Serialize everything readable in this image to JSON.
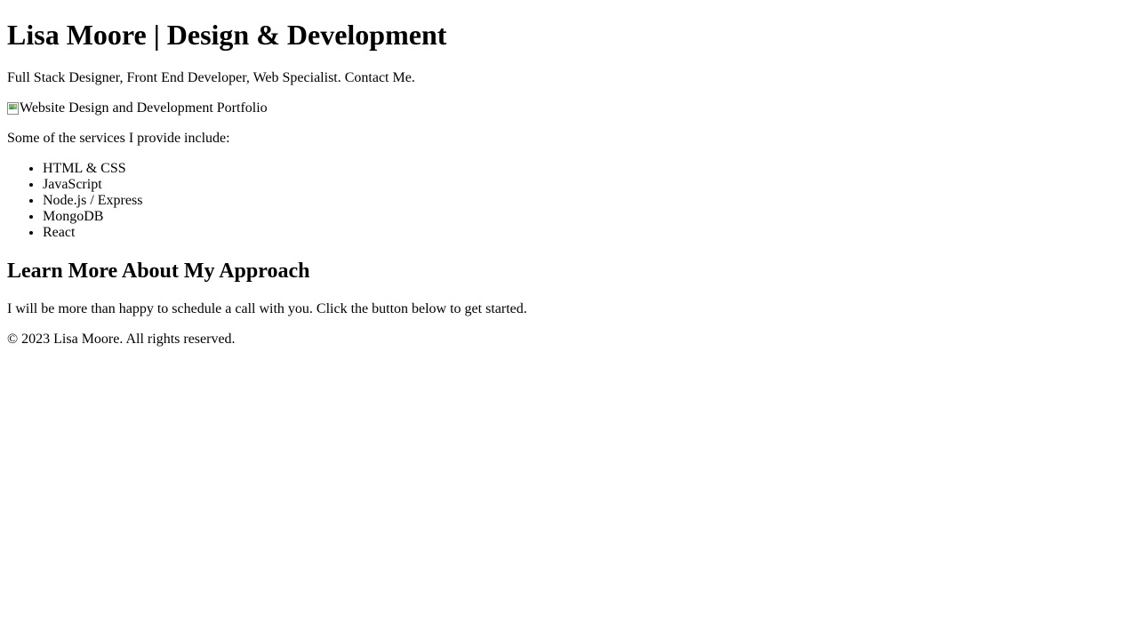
{
  "header": {
    "title": "Lisa Moore | Design & Development",
    "tagline": "Full Stack Designer, Front End Developer, Web Specialist. Contact Me."
  },
  "hero_image": {
    "alt": "Website Design and Development Portfolio",
    "icon": "broken-image-icon"
  },
  "services": {
    "intro": "Some of the services I provide include:",
    "items": [
      "HTML & CSS",
      "JavaScript",
      "Node.js / Express",
      "MongoDB",
      "React"
    ]
  },
  "approach": {
    "heading": "Learn More About My Approach",
    "text": "I will be more than happy to schedule a call with you. Click the button below to get started."
  },
  "footer": {
    "copyright": "© 2023 Lisa Moore. All rights reserved."
  }
}
